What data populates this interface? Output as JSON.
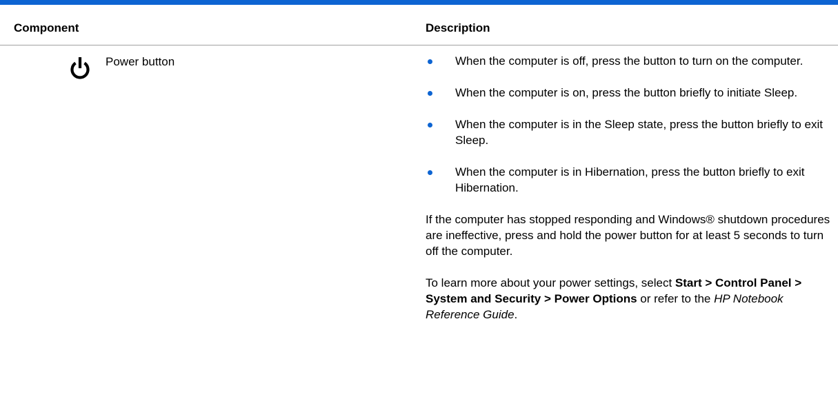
{
  "table": {
    "header": {
      "component": "Component",
      "description": "Description"
    },
    "row": {
      "icon": "power-icon",
      "component_name": "Power button",
      "bullets": [
        "When the computer is off, press the button to turn on the computer.",
        "When the computer is on, press the button briefly to initiate Sleep.",
        "When the computer is in the Sleep state, press the button briefly to exit Sleep.",
        "When the computer is in Hibernation, press the button briefly to exit Hibernation."
      ],
      "note_stopped": "If the computer has stopped responding and Windows® shutdown procedures are ineffective, press and hold the power button for at least 5 seconds to turn off the computer.",
      "learn_more": {
        "prefix": "To learn more about your power settings, select ",
        "path": "Start > Control Panel > System and Security > Power Options",
        "middle": " or refer to the ",
        "guide": "HP Notebook Reference Guide",
        "suffix": "."
      }
    }
  },
  "colors": {
    "accent": "#0d64d2",
    "rule": "#a0a0a0"
  }
}
